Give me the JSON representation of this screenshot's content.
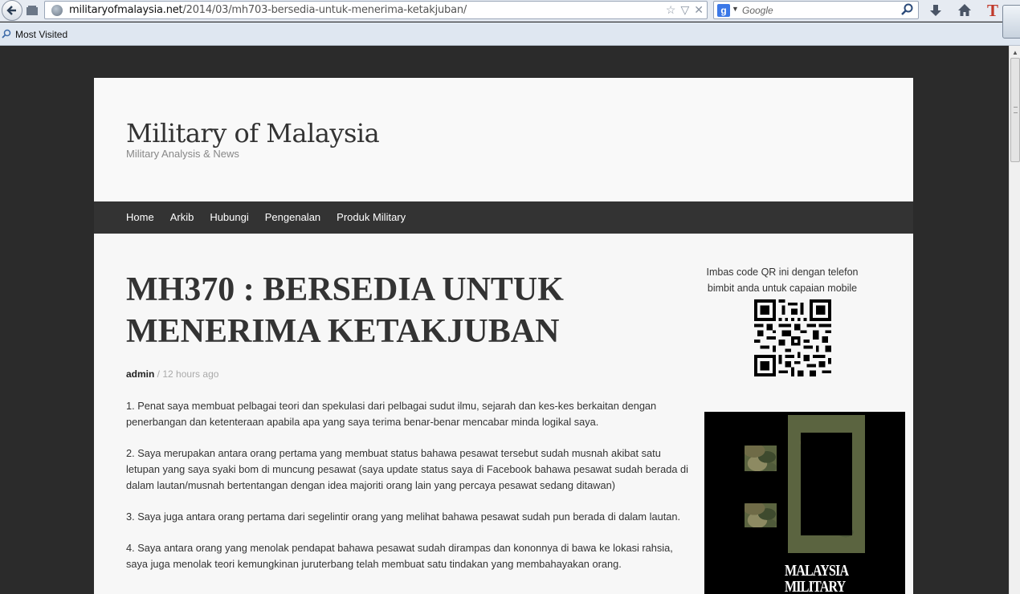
{
  "browser": {
    "url_domain": "militaryofmalaysia.net",
    "url_path": "/2014/03/mh703-bersedia-untuk-menerima-ketakjuban/",
    "search_placeholder": "Google",
    "search_engine_letter": "g",
    "bookmark_label": "Most Visited",
    "toolbar_extra_letter": "T"
  },
  "site": {
    "title": "Military of Malaysia",
    "tagline": "Military Analysis & News"
  },
  "nav": [
    "Home",
    "Arkib",
    "Hubungi",
    "Pengenalan",
    "Produk Military"
  ],
  "post": {
    "title": "MH370 : BERSEDIA UNTUK MENERIMA KETAKJUBAN",
    "author": "admin",
    "separator": " / ",
    "time": "12 hours ago",
    "paragraphs": [
      "1. Penat saya membuat pelbagai teori dan spekulasi dari pelbagai sudut ilmu, sejarah dan kes-kes berkaitan dengan penerbangan dan ketenteraan apabila apa yang saya terima benar-benar mencabar minda logikal saya.",
      "2. Saya merupakan antara orang pertama yang membuat status bahawa pesawat tersebut sudah musnah akibat satu letupan yang saya syaki bom di muncung pesawat (saya update status saya di Facebook bahawa pesawat sudah berada di dalam lautan/musnah bertentangan dengan idea majoriti orang lain yang percaya pesawat sedang ditawan)",
      "3. Saya juga antara orang pertama dari segelintir orang yang melihat bahawa pesawat sudah pun berada di dalam lautan.",
      "4. Saya antara orang yang menolak pendapat bahawa pesawat sudah dirampas dan kononnya di bawa ke lokasi rahsia, saya juga menolak teori kemungkinan juruterbang telah membuat satu tindakan yang membahayakan orang."
    ]
  },
  "sidebar": {
    "qr_text": "Imbas code QR ini dengan telefon bimbit anda untuk capaian mobile",
    "banner_text": "MALAYSIA MILITARY"
  }
}
